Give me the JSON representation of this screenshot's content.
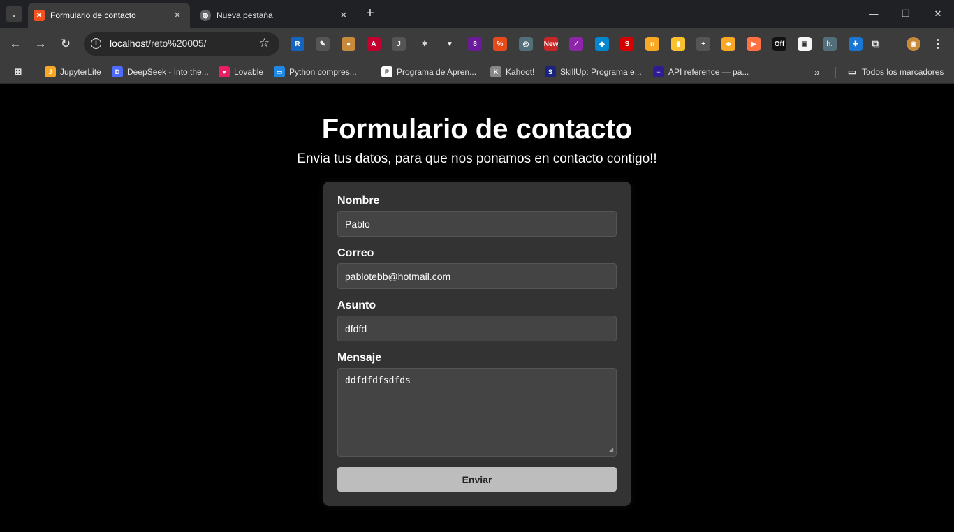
{
  "browser": {
    "tabs": [
      {
        "title": "Formulario de contacto",
        "favicon_color": "#f4511e"
      },
      {
        "title": "Nueva pestaña"
      }
    ],
    "address": {
      "host": "localhost",
      "path": "/reto%20005/"
    },
    "extensions": [
      {
        "name": "r-extension",
        "text": "R",
        "color": "#1565c0"
      },
      {
        "name": "eyedropper-icon",
        "text": "✎",
        "color": "#555555"
      },
      {
        "name": "cookie-icon",
        "text": "●",
        "color": "#c88a3a"
      },
      {
        "name": "angular-icon",
        "text": "A",
        "color": "#c3002f"
      },
      {
        "name": "java-icon",
        "text": "J",
        "color": "#555555"
      },
      {
        "name": "react-icon",
        "text": "⚛",
        "color": "#3c3c3c"
      },
      {
        "name": "vue-icon",
        "text": "▼",
        "color": "#3c3c3c"
      },
      {
        "name": "badge-extension",
        "text": "8",
        "color": "#6a1b9a"
      },
      {
        "name": "percent-extension",
        "text": "%",
        "color": "#e64a19"
      },
      {
        "name": "ring-extension",
        "text": "◎",
        "color": "#546e7a"
      },
      {
        "name": "new-extension",
        "text": "New",
        "color": "#c62828"
      },
      {
        "name": "feather-icon",
        "text": "∕",
        "color": "#8e24aa"
      },
      {
        "name": "compass-extension",
        "text": "◆",
        "color": "#0288d1"
      },
      {
        "name": "s-extension",
        "text": "S",
        "color": "#d50000"
      },
      {
        "name": "yellow-extension",
        "text": "n",
        "color": "#f9a825"
      },
      {
        "name": "bars-extension",
        "text": "▮",
        "color": "#fbc02d"
      },
      {
        "name": "crosshair-icon",
        "text": "+",
        "color": "#555555"
      },
      {
        "name": "smiley-extension",
        "text": "☻",
        "color": "#f9a825"
      },
      {
        "name": "flag-extension",
        "text": "▶",
        "color": "#ff7043"
      },
      {
        "name": "off-extension",
        "text": "Off",
        "color": "#111111"
      },
      {
        "name": "frame-extension",
        "text": "▣",
        "color": "#f5f5f5"
      },
      {
        "name": "h-extension",
        "text": "h.",
        "color": "#546e7a"
      },
      {
        "name": "puzzle-blue-icon",
        "text": "✚",
        "color": "#1976d2"
      }
    ],
    "bookmarks": [
      {
        "label": "JupyterLite",
        "icon_color": "#f9a825",
        "icon_text": "J"
      },
      {
        "label": "DeepSeek - Into the...",
        "icon_color": "#4d6bfe",
        "icon_text": "D"
      },
      {
        "label": "Lovable",
        "icon_color": "#e91e63",
        "icon_text": "♥"
      },
      {
        "label": "Python compres...",
        "icon_color": "#1e88e5",
        "icon_text": "▭"
      },
      {
        "label": "Programa de Apren...",
        "icon_color": "#ffffff",
        "icon_text": "P"
      },
      {
        "label": "Kahoot!",
        "icon_color": "#888888",
        "icon_text": "K"
      },
      {
        "label": "SkillUp: Programa e...",
        "icon_color": "#1a237e",
        "icon_text": "S"
      },
      {
        "label": "API reference — pa...",
        "icon_color": "#311b92",
        "icon_text": "≡"
      }
    ],
    "all_bookmarks": "Todos los marcadores"
  },
  "page": {
    "title": "Formulario de contacto",
    "subtitle": "Envia tus datos, para que nos ponamos en contacto contigo!!",
    "form": {
      "nombre_label": "Nombre",
      "nombre_value": "Pablo",
      "correo_label": "Correo",
      "correo_value": "pablotebb@hotmail.com",
      "asunto_label": "Asunto",
      "asunto_value": "dfdfd",
      "mensaje_label": "Mensaje",
      "mensaje_value": "ddfdfdfsdfds",
      "submit_label": "Enviar"
    }
  }
}
